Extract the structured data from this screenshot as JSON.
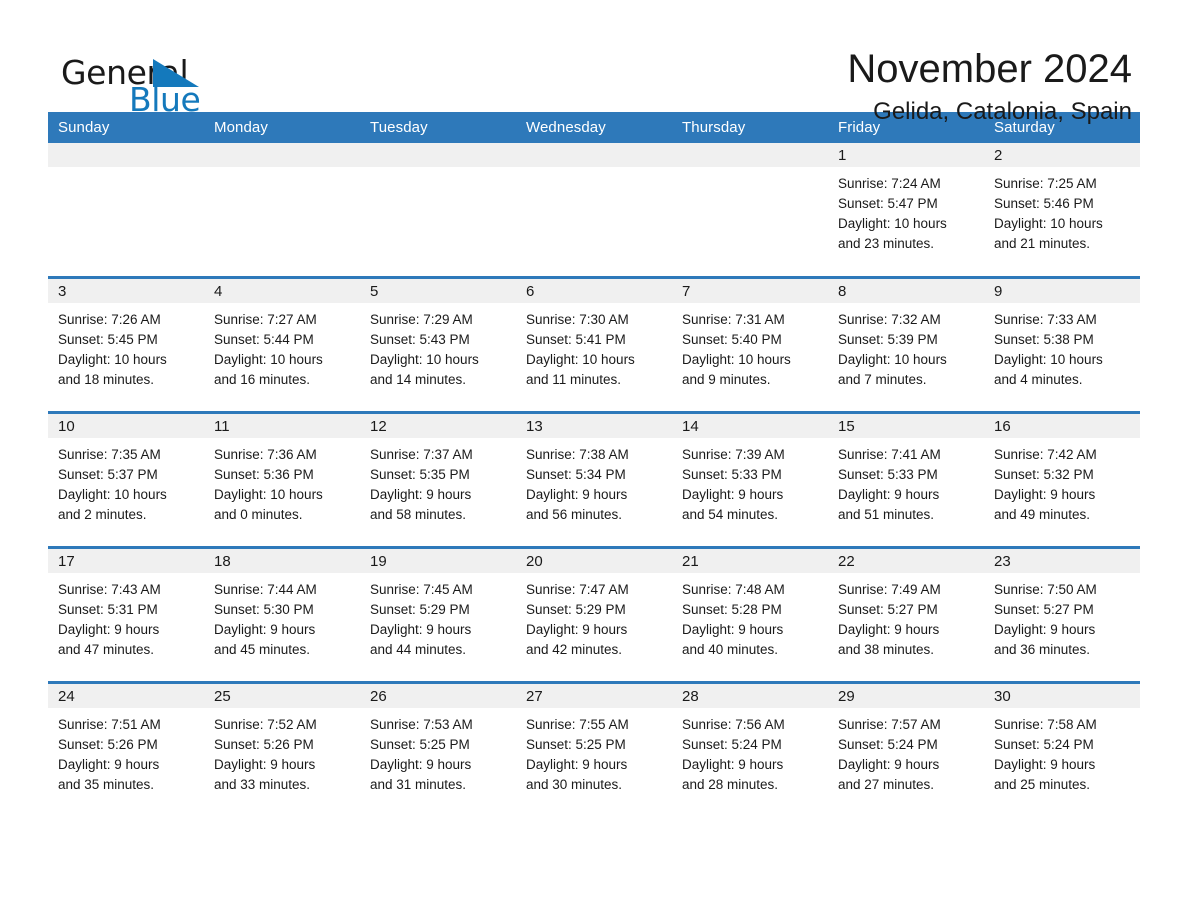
{
  "brand": {
    "name_part1": "General",
    "name_part2": "Blue",
    "flag_icon": "triangle-flag-icon",
    "accent_color": "#1479bc"
  },
  "header": {
    "month_title": "November 2024",
    "location": "Gelida, Catalonia, Spain"
  },
  "calendar": {
    "header_color": "#2e79ba",
    "daynum_band_color": "#f0f0f0",
    "weekday_headers": [
      "Sunday",
      "Monday",
      "Tuesday",
      "Wednesday",
      "Thursday",
      "Friday",
      "Saturday"
    ],
    "weeks": [
      [
        {
          "day": "",
          "empty": true
        },
        {
          "day": "",
          "empty": true
        },
        {
          "day": "",
          "empty": true
        },
        {
          "day": "",
          "empty": true
        },
        {
          "day": "",
          "empty": true
        },
        {
          "day": "1",
          "sunrise": "Sunrise: 7:24 AM",
          "sunset": "Sunset: 5:47 PM",
          "daylight_l1": "Daylight: 10 hours",
          "daylight_l2": "and 23 minutes."
        },
        {
          "day": "2",
          "sunrise": "Sunrise: 7:25 AM",
          "sunset": "Sunset: 5:46 PM",
          "daylight_l1": "Daylight: 10 hours",
          "daylight_l2": "and 21 minutes."
        }
      ],
      [
        {
          "day": "3",
          "sunrise": "Sunrise: 7:26 AM",
          "sunset": "Sunset: 5:45 PM",
          "daylight_l1": "Daylight: 10 hours",
          "daylight_l2": "and 18 minutes."
        },
        {
          "day": "4",
          "sunrise": "Sunrise: 7:27 AM",
          "sunset": "Sunset: 5:44 PM",
          "daylight_l1": "Daylight: 10 hours",
          "daylight_l2": "and 16 minutes."
        },
        {
          "day": "5",
          "sunrise": "Sunrise: 7:29 AM",
          "sunset": "Sunset: 5:43 PM",
          "daylight_l1": "Daylight: 10 hours",
          "daylight_l2": "and 14 minutes."
        },
        {
          "day": "6",
          "sunrise": "Sunrise: 7:30 AM",
          "sunset": "Sunset: 5:41 PM",
          "daylight_l1": "Daylight: 10 hours",
          "daylight_l2": "and 11 minutes."
        },
        {
          "day": "7",
          "sunrise": "Sunrise: 7:31 AM",
          "sunset": "Sunset: 5:40 PM",
          "daylight_l1": "Daylight: 10 hours",
          "daylight_l2": "and 9 minutes."
        },
        {
          "day": "8",
          "sunrise": "Sunrise: 7:32 AM",
          "sunset": "Sunset: 5:39 PM",
          "daylight_l1": "Daylight: 10 hours",
          "daylight_l2": "and 7 minutes."
        },
        {
          "day": "9",
          "sunrise": "Sunrise: 7:33 AM",
          "sunset": "Sunset: 5:38 PM",
          "daylight_l1": "Daylight: 10 hours",
          "daylight_l2": "and 4 minutes."
        }
      ],
      [
        {
          "day": "10",
          "sunrise": "Sunrise: 7:35 AM",
          "sunset": "Sunset: 5:37 PM",
          "daylight_l1": "Daylight: 10 hours",
          "daylight_l2": "and 2 minutes."
        },
        {
          "day": "11",
          "sunrise": "Sunrise: 7:36 AM",
          "sunset": "Sunset: 5:36 PM",
          "daylight_l1": "Daylight: 10 hours",
          "daylight_l2": "and 0 minutes."
        },
        {
          "day": "12",
          "sunrise": "Sunrise: 7:37 AM",
          "sunset": "Sunset: 5:35 PM",
          "daylight_l1": "Daylight: 9 hours",
          "daylight_l2": "and 58 minutes."
        },
        {
          "day": "13",
          "sunrise": "Sunrise: 7:38 AM",
          "sunset": "Sunset: 5:34 PM",
          "daylight_l1": "Daylight: 9 hours",
          "daylight_l2": "and 56 minutes."
        },
        {
          "day": "14",
          "sunrise": "Sunrise: 7:39 AM",
          "sunset": "Sunset: 5:33 PM",
          "daylight_l1": "Daylight: 9 hours",
          "daylight_l2": "and 54 minutes."
        },
        {
          "day": "15",
          "sunrise": "Sunrise: 7:41 AM",
          "sunset": "Sunset: 5:33 PM",
          "daylight_l1": "Daylight: 9 hours",
          "daylight_l2": "and 51 minutes."
        },
        {
          "day": "16",
          "sunrise": "Sunrise: 7:42 AM",
          "sunset": "Sunset: 5:32 PM",
          "daylight_l1": "Daylight: 9 hours",
          "daylight_l2": "and 49 minutes."
        }
      ],
      [
        {
          "day": "17",
          "sunrise": "Sunrise: 7:43 AM",
          "sunset": "Sunset: 5:31 PM",
          "daylight_l1": "Daylight: 9 hours",
          "daylight_l2": "and 47 minutes."
        },
        {
          "day": "18",
          "sunrise": "Sunrise: 7:44 AM",
          "sunset": "Sunset: 5:30 PM",
          "daylight_l1": "Daylight: 9 hours",
          "daylight_l2": "and 45 minutes."
        },
        {
          "day": "19",
          "sunrise": "Sunrise: 7:45 AM",
          "sunset": "Sunset: 5:29 PM",
          "daylight_l1": "Daylight: 9 hours",
          "daylight_l2": "and 44 minutes."
        },
        {
          "day": "20",
          "sunrise": "Sunrise: 7:47 AM",
          "sunset": "Sunset: 5:29 PM",
          "daylight_l1": "Daylight: 9 hours",
          "daylight_l2": "and 42 minutes."
        },
        {
          "day": "21",
          "sunrise": "Sunrise: 7:48 AM",
          "sunset": "Sunset: 5:28 PM",
          "daylight_l1": "Daylight: 9 hours",
          "daylight_l2": "and 40 minutes."
        },
        {
          "day": "22",
          "sunrise": "Sunrise: 7:49 AM",
          "sunset": "Sunset: 5:27 PM",
          "daylight_l1": "Daylight: 9 hours",
          "daylight_l2": "and 38 minutes."
        },
        {
          "day": "23",
          "sunrise": "Sunrise: 7:50 AM",
          "sunset": "Sunset: 5:27 PM",
          "daylight_l1": "Daylight: 9 hours",
          "daylight_l2": "and 36 minutes."
        }
      ],
      [
        {
          "day": "24",
          "sunrise": "Sunrise: 7:51 AM",
          "sunset": "Sunset: 5:26 PM",
          "daylight_l1": "Daylight: 9 hours",
          "daylight_l2": "and 35 minutes."
        },
        {
          "day": "25",
          "sunrise": "Sunrise: 7:52 AM",
          "sunset": "Sunset: 5:26 PM",
          "daylight_l1": "Daylight: 9 hours",
          "daylight_l2": "and 33 minutes."
        },
        {
          "day": "26",
          "sunrise": "Sunrise: 7:53 AM",
          "sunset": "Sunset: 5:25 PM",
          "daylight_l1": "Daylight: 9 hours",
          "daylight_l2": "and 31 minutes."
        },
        {
          "day": "27",
          "sunrise": "Sunrise: 7:55 AM",
          "sunset": "Sunset: 5:25 PM",
          "daylight_l1": "Daylight: 9 hours",
          "daylight_l2": "and 30 minutes."
        },
        {
          "day": "28",
          "sunrise": "Sunrise: 7:56 AM",
          "sunset": "Sunset: 5:24 PM",
          "daylight_l1": "Daylight: 9 hours",
          "daylight_l2": "and 28 minutes."
        },
        {
          "day": "29",
          "sunrise": "Sunrise: 7:57 AM",
          "sunset": "Sunset: 5:24 PM",
          "daylight_l1": "Daylight: 9 hours",
          "daylight_l2": "and 27 minutes."
        },
        {
          "day": "30",
          "sunrise": "Sunrise: 7:58 AM",
          "sunset": "Sunset: 5:24 PM",
          "daylight_l1": "Daylight: 9 hours",
          "daylight_l2": "and 25 minutes."
        }
      ]
    ]
  }
}
